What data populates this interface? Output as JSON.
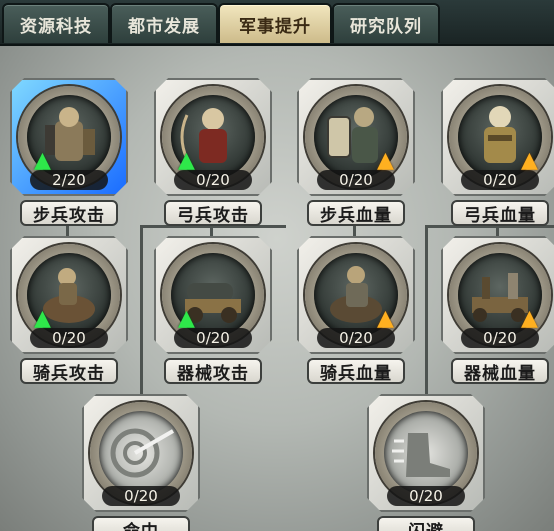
{
  "tabs": [
    {
      "label": "资源科技",
      "active": false
    },
    {
      "label": "都市发展",
      "active": false
    },
    {
      "label": "军事提升",
      "active": true
    },
    {
      "label": "研究队列",
      "active": false
    }
  ],
  "nodes": [
    {
      "label": "步兵攻击",
      "count": "2/20",
      "arrow": "green",
      "icon": "infantry-warrior-icon",
      "selected": true
    },
    {
      "label": "弓兵攻击",
      "count": "0/20",
      "arrow": "green",
      "icon": "archer-warrior-icon"
    },
    {
      "label": "步兵血量",
      "count": "0/20",
      "arrow": "orange",
      "icon": "shield-warrior-icon"
    },
    {
      "label": "弓兵血量",
      "count": "0/20",
      "arrow": "orange",
      "icon": "armored-archer-icon"
    },
    {
      "label": "骑兵攻击",
      "count": "0/20",
      "arrow": "green",
      "icon": "cavalry-rider-icon"
    },
    {
      "label": "器械攻击",
      "count": "0/20",
      "arrow": "green",
      "icon": "siege-cannon-icon"
    },
    {
      "label": "骑兵血量",
      "count": "0/20",
      "arrow": "orange",
      "icon": "armored-cavalry-icon"
    },
    {
      "label": "器械血量",
      "count": "0/20",
      "arrow": "orange",
      "icon": "siege-catapult-icon"
    },
    {
      "label": "命中",
      "count": "0/20",
      "arrow": "",
      "icon": "accuracy-target-icon"
    },
    {
      "label": "闪避",
      "count": "0/20",
      "arrow": "",
      "icon": "dodge-boot-icon"
    }
  ]
}
